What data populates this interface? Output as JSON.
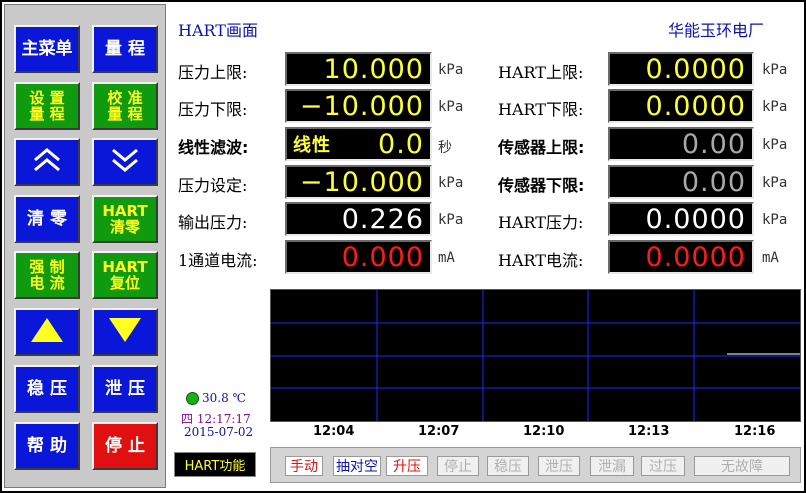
{
  "header": {
    "title": "HART画面",
    "company": "华能玉环电厂"
  },
  "left_buttons": [
    {
      "label": "主菜单",
      "style": "blue"
    },
    {
      "label": "量 程",
      "style": "blue"
    },
    {
      "label": "设 置\n量 程",
      "style": "green"
    },
    {
      "label": "校 准\n量 程",
      "style": "green"
    },
    {
      "label": "",
      "icon": "double-chevron-up-icon",
      "style": "blue"
    },
    {
      "label": "",
      "icon": "double-chevron-down-icon",
      "style": "blue"
    },
    {
      "label": "清 零",
      "style": "blue"
    },
    {
      "label": "HART\n清零",
      "style": "green"
    },
    {
      "label": "强 制\n电 流",
      "style": "green"
    },
    {
      "label": "HART\n复位",
      "style": "green"
    },
    {
      "label": "",
      "icon": "triangle-up-icon",
      "style": "blue"
    },
    {
      "label": "",
      "icon": "triangle-down-icon",
      "style": "blue"
    },
    {
      "label": "稳 压",
      "style": "blue"
    },
    {
      "label": "泄 压",
      "style": "blue"
    },
    {
      "label": "帮 助",
      "style": "blue"
    },
    {
      "label": "停 止",
      "style": "red"
    }
  ],
  "rows_left": [
    {
      "label": "压力上限:",
      "value": "10.000",
      "unit": "kPa",
      "color": "yel"
    },
    {
      "label": "压力下限:",
      "value": "−10.000",
      "unit": "kPa",
      "color": "yel"
    },
    {
      "label": "线性滤波:",
      "prefix": "线性",
      "value": "0.0",
      "unit": "秒",
      "color": "yel"
    },
    {
      "label": "压力设定:",
      "value": "−10.000",
      "unit": "kPa",
      "color": "yel"
    },
    {
      "label": "输出压力:",
      "value": "0.226",
      "unit": "kPa",
      "color": "wht"
    },
    {
      "label": "1通道电流:",
      "value": "0.000",
      "unit": "mA",
      "color": "red"
    }
  ],
  "rows_right": [
    {
      "label": "HART上限:",
      "value": "0.0000",
      "unit": "kPa",
      "color": "yel"
    },
    {
      "label": "HART下限:",
      "value": "0.0000",
      "unit": "kPa",
      "color": "yel"
    },
    {
      "label": "传感器上限:",
      "value": "0.00",
      "unit": "kPa",
      "color": "gry"
    },
    {
      "label": "传感器下限:",
      "value": "0.00",
      "unit": "kPa",
      "color": "gry"
    },
    {
      "label": "HART压力:",
      "value": "0.0000",
      "unit": "kPa",
      "color": "wht"
    },
    {
      "label": "HART电流:",
      "value": "0.0000",
      "unit": "mA",
      "color": "red"
    }
  ],
  "status_left": {
    "temperature": "30.8 ℃",
    "clock": "四 12:17:17",
    "date": "2015-07-02"
  },
  "chart": {
    "x_ticks": [
      "12:04",
      "12:07",
      "12:10",
      "12:13",
      "12:16"
    ],
    "grid_color": "#1a2cff"
  },
  "hart_function_label": "HART功能",
  "status_indicators": [
    {
      "label": "手动",
      "state": "on-red"
    },
    {
      "label": "抽对空",
      "state": "on-blue"
    },
    {
      "label": "升压",
      "state": "on-red"
    },
    {
      "label": "停止",
      "state": "off"
    },
    {
      "label": "稳压",
      "state": "off"
    },
    {
      "label": "泄压",
      "state": "off"
    },
    {
      "label": "泄漏",
      "state": "off"
    },
    {
      "label": "过压",
      "state": "off"
    },
    {
      "label": "无故障",
      "state": "off"
    }
  ]
}
